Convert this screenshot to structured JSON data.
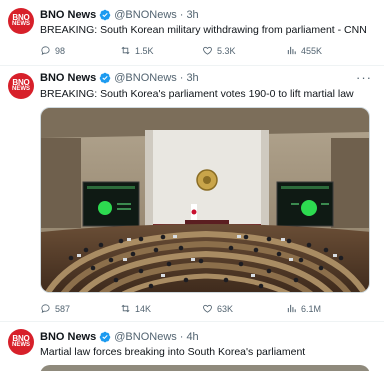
{
  "tweets": [
    {
      "avatar_line1": "BNO",
      "avatar_line2": "NEWS",
      "name": "BNO News",
      "handle": "@BNONews",
      "dot": "·",
      "time": "3h",
      "text": "BREAKING: South Korean military withdrawing from parliament - CNN",
      "replies": "98",
      "reposts": "1.5K",
      "likes": "5.3K",
      "views": "455K"
    },
    {
      "avatar_line1": "BNO",
      "avatar_line2": "NEWS",
      "name": "BNO News",
      "handle": "@BNONews",
      "dot": "·",
      "time": "3h",
      "text": "BREAKING: South Korea's parliament votes 190-0 to lift martial law",
      "replies": "587",
      "reposts": "14K",
      "likes": "63K",
      "views": "6.1M"
    },
    {
      "avatar_line1": "BNO",
      "avatar_line2": "NEWS",
      "name": "BNO News",
      "handle": "@BNONews",
      "dot": "·",
      "time": "4h",
      "text": "Martial law forces breaking into South Korea's parliament"
    }
  ],
  "colors": {
    "brand_red": "#d7202a",
    "verified_blue": "#1d9bf0",
    "muted": "#536471"
  }
}
